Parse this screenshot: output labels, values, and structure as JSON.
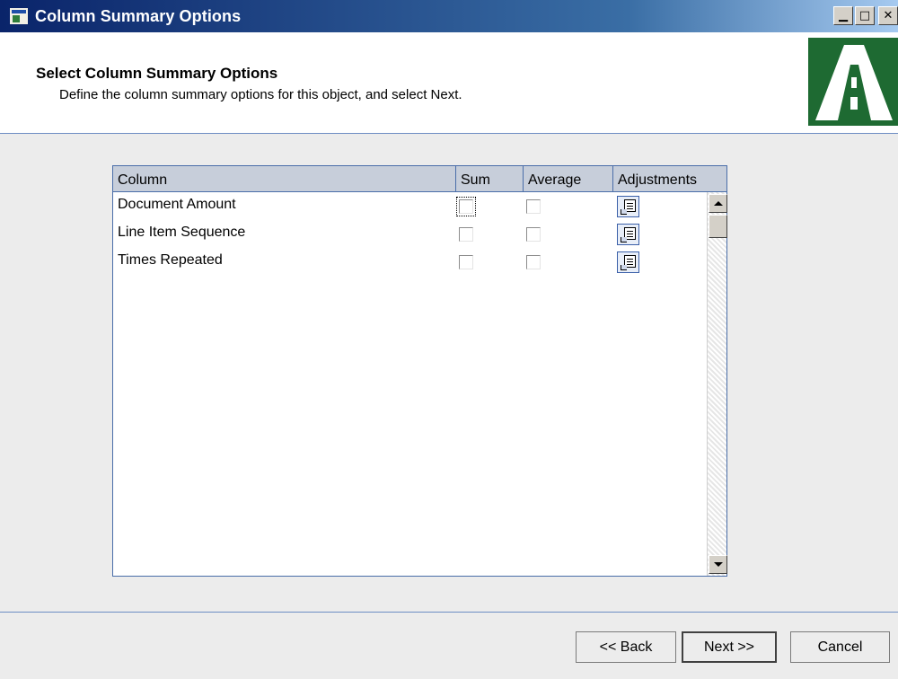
{
  "window": {
    "title": "Column Summary Options",
    "controls": [
      "minimize",
      "maximize",
      "close"
    ]
  },
  "header": {
    "title": "Select Column Summary Options",
    "subtitle": "Define the column summary options for this object, and select Next."
  },
  "grid": {
    "columns": [
      "Column",
      "Sum",
      "Average",
      "Adjustments"
    ],
    "rows": [
      {
        "name": "Document Amount",
        "sum": false,
        "average": false
      },
      {
        "name": "Line Item Sequence",
        "sum": false,
        "average": false
      },
      {
        "name": "Times Repeated",
        "sum": false,
        "average": false
      }
    ]
  },
  "buttons": {
    "back": "<< Back",
    "next": "Next >>",
    "cancel": "Cancel"
  },
  "colors": {
    "title_bar": "#0a246a",
    "accent_border": "#4a6ea9",
    "logo_green": "#1e6a32"
  }
}
